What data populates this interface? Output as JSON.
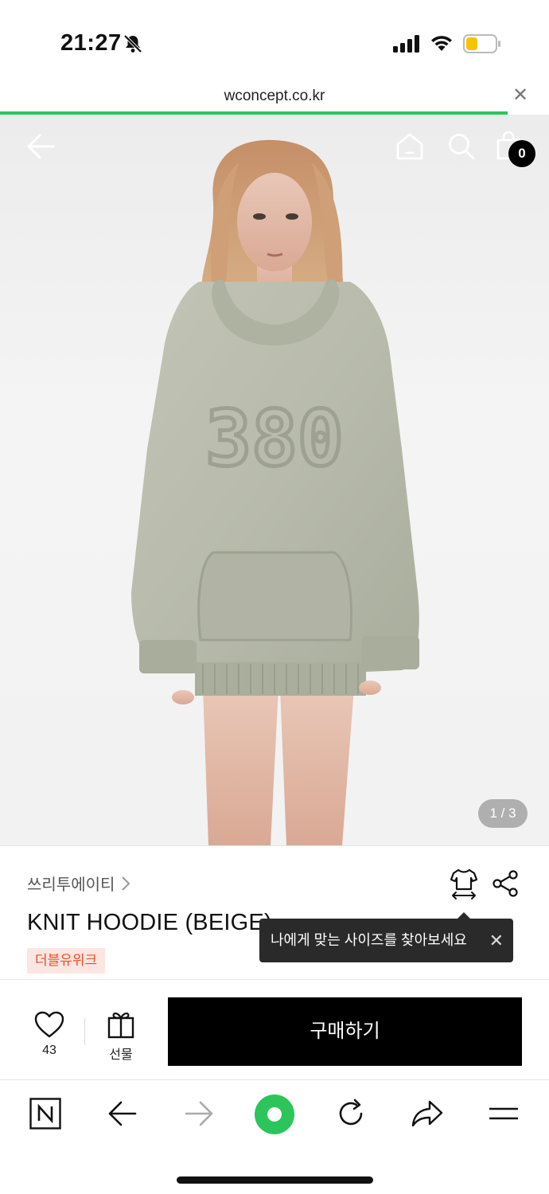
{
  "status_bar": {
    "time": "21:27"
  },
  "browser": {
    "url": "wconcept.co.kr"
  },
  "product": {
    "image_counter": "1 / 3",
    "sweater_print": "380",
    "brand": "쓰리투에이티",
    "title": "KNIT HOODIE (BEIGE)",
    "tag": "더블유위크",
    "size_tooltip": "나에게 맞는 사이즈를 찾아보세요",
    "likes": "43",
    "gift_label": "선물",
    "buy_label": "구매하기"
  },
  "header": {
    "cart_count": "0"
  },
  "colors": {
    "accent_green": "#2bc55b",
    "buy_button": "#000000",
    "tag_bg": "#fbe6e1",
    "tag_text": "#e8502a",
    "sweater": "#b8bbab"
  },
  "icons": [
    "bell-off-icon",
    "signal-icon",
    "wifi-icon",
    "battery-icon",
    "close-icon",
    "back-arrow-icon",
    "home-icon",
    "search-icon",
    "cart-icon",
    "chevron-right-icon",
    "size-guide-icon",
    "share-icon",
    "heart-icon",
    "gift-icon",
    "naver-icon",
    "forward-arrow-icon",
    "green-dot-icon",
    "reload-icon",
    "share-arrow-icon",
    "menu-icon"
  ]
}
